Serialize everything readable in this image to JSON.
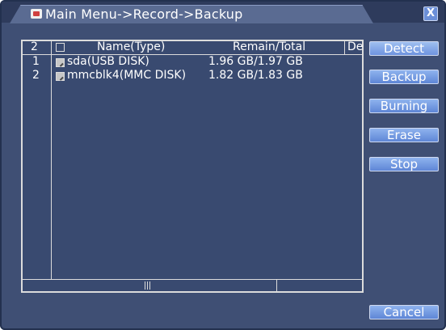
{
  "window": {
    "title": "Main Menu->Record->Backup",
    "close_label": "X"
  },
  "table": {
    "header": {
      "count": "2",
      "name_type": "Name(Type)",
      "remain_total": "Remain/Total",
      "device": "De"
    },
    "rows": [
      {
        "index": "1",
        "name": "sda(USB DISK)",
        "space": "1.96 GB/1.97 GB",
        "checked": true
      },
      {
        "index": "2",
        "name": "mmcblk4(MMC DISK)",
        "space": "1.82 GB/1.83 GB",
        "checked": true
      }
    ]
  },
  "buttons": {
    "detect": "Detect",
    "backup": "Backup",
    "burning": "Burning",
    "erase": "Erase",
    "stop": "Stop",
    "cancel": "Cancel"
  }
}
